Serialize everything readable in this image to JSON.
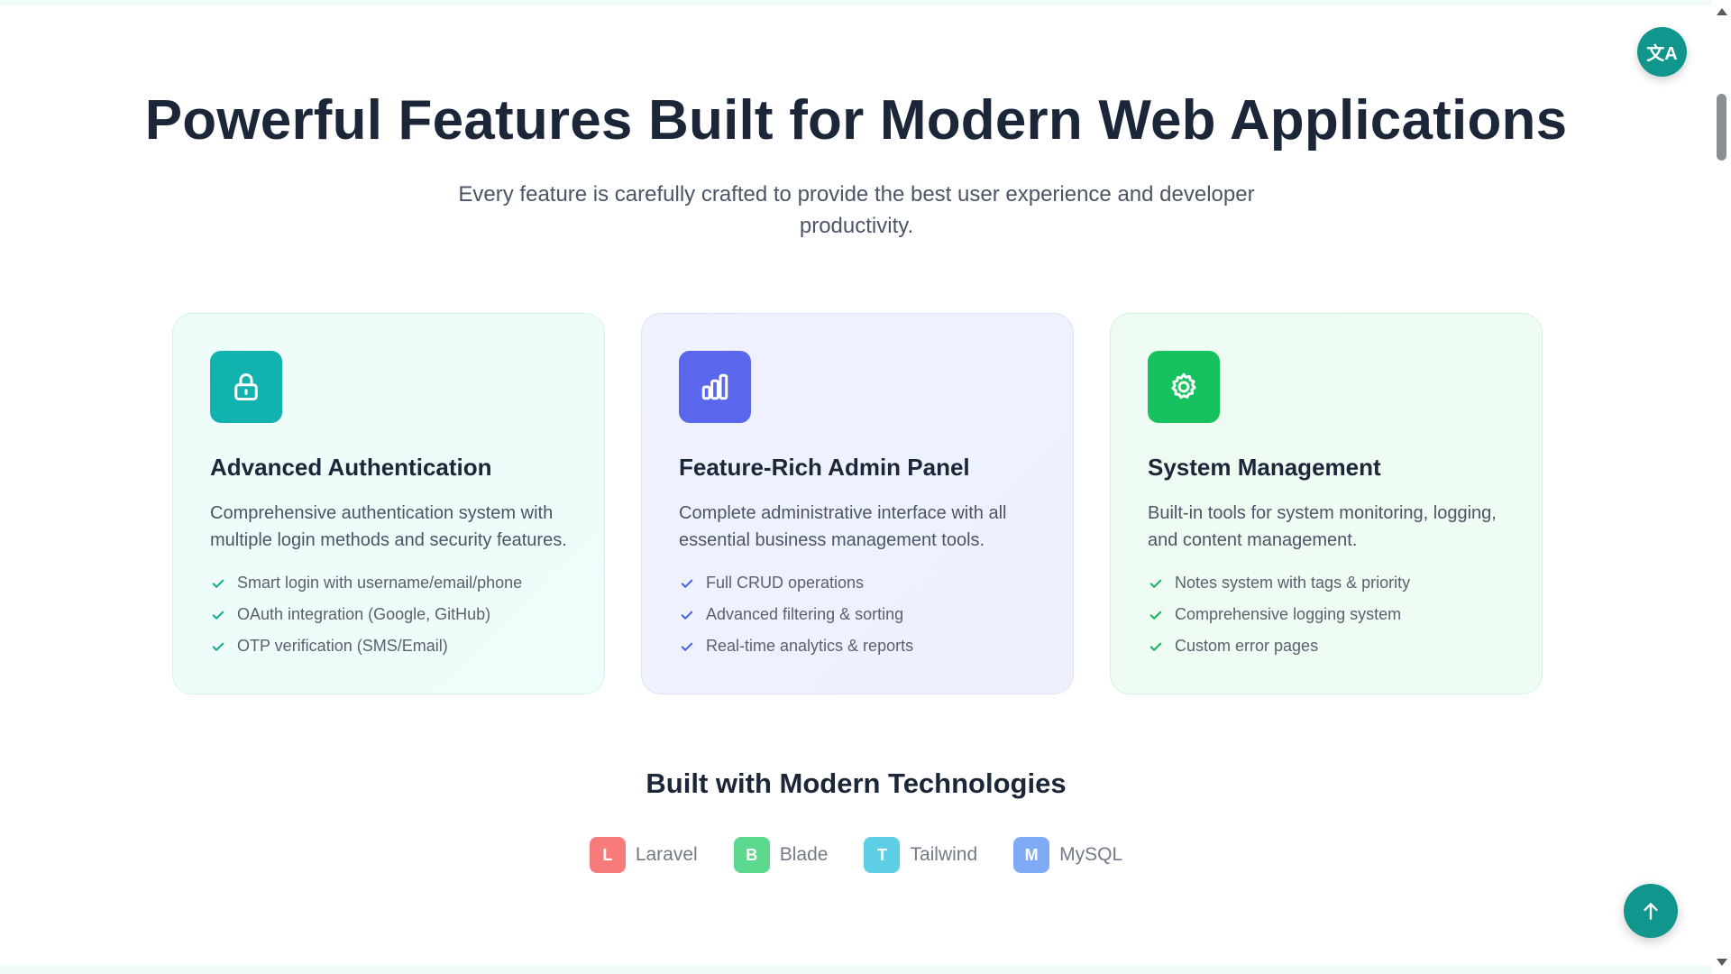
{
  "header": {
    "title": "Powerful Features Built for Modern Web Applications",
    "subtitle": "Every feature is carefully crafted to provide the best user experience and developer productivity."
  },
  "cards": [
    {
      "icon": "lock-icon",
      "title": "Advanced Authentication",
      "description": "Comprehensive authentication system with multiple login methods and security features.",
      "features": [
        "Smart login with username/email/phone",
        "OAuth integration (Google, GitHub)",
        "OTP verification (SMS/Email)"
      ],
      "accent": "#12b3ae"
    },
    {
      "icon": "bar-chart-icon",
      "title": "Feature-Rich Admin Panel",
      "description": "Complete administrative interface with all essential business management tools.",
      "features": [
        "Full CRUD operations",
        "Advanced filtering & sorting",
        "Real-time analytics & reports"
      ],
      "accent": "#5a67ec"
    },
    {
      "icon": "gear-icon",
      "title": "System Management",
      "description": "Built-in tools for system monitoring, logging, and content management.",
      "features": [
        "Notes system with tags & priority",
        "Comprehensive logging system",
        "Custom error pages"
      ],
      "accent": "#16c25d"
    }
  ],
  "tech": {
    "title": "Built with Modern Technologies",
    "items": [
      {
        "letter": "L",
        "label": "Laravel",
        "color": "#f87b7b"
      },
      {
        "letter": "B",
        "label": "Blade",
        "color": "#5dd98f"
      },
      {
        "letter": "T",
        "label": "Tailwind",
        "color": "#5fcfe6"
      },
      {
        "letter": "M",
        "label": "MySQL",
        "color": "#7fabf6"
      }
    ]
  },
  "floating": {
    "translate_icon": "translate-icon",
    "translate_glyph": "文A",
    "back_to_top_icon": "arrow-up-icon"
  },
  "colors": {
    "check": "#12a89a",
    "button": "#11968d"
  }
}
